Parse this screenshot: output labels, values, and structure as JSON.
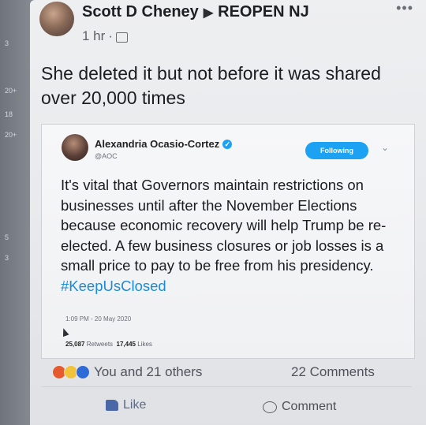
{
  "sidebar_counts": [
    "3",
    "20+",
    "18",
    "20+",
    "5",
    "3"
  ],
  "post": {
    "author": "Scott D Cheney",
    "group": "REOPEN NJ",
    "time": "1 hr",
    "text": "She deleted it but not before it was shared over 20,000 times",
    "more_icon": "more-dots-icon"
  },
  "tweet": {
    "name": "Alexandria Ocasio-Cortez",
    "handle": "@AOC",
    "follow_label": "Following",
    "body": "It's vital that Governors maintain restrictions on businesses until after the November Elections because economic recovery will help Trump be re-elected. A few business closures or job losses is a small price to pay to be free from his presidency.",
    "hashtag": "#KeepUsClosed",
    "timestamp": "1:09 PM - 20 May 2020",
    "retweets_count": "25,087",
    "retweets_label": "Retweets",
    "likes_count": "17,445",
    "likes_label": "Likes"
  },
  "engagement": {
    "reactions_text": "You and 21 others",
    "comments_text": "22 Comments"
  },
  "actions": {
    "like_label": "Like",
    "comment_label": "Comment"
  },
  "colors": {
    "twitter_blue": "#1da1f2",
    "hashtag": "#1d8ad8",
    "like_blue": "#4a67a7"
  }
}
